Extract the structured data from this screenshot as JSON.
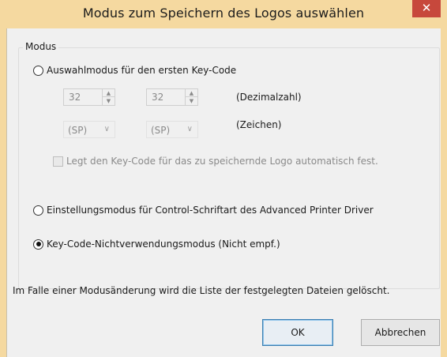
{
  "window": {
    "title": "Modus zum Speichern des Logos auswählen",
    "close_glyph": "✕"
  },
  "group": {
    "label": "Modus"
  },
  "options": [
    {
      "label": "Auswahlmodus für den ersten Key-Code",
      "checked": false
    },
    {
      "label": "Einstellungsmodus für Control-Schriftart des Advanced Printer Driver",
      "checked": false
    },
    {
      "label": "Key-Code-Nichtverwendungsmodus (Nicht empf.)",
      "checked": true
    }
  ],
  "keycode": {
    "spin1_value": "32",
    "spin2_value": "32",
    "decimal_label": "(Dezimalzahl)",
    "combo1_value": "(SP)",
    "combo2_value": "(SP)",
    "char_label": "(Zeichen)",
    "auto_checkbox_label": "Legt den Key-Code für das zu speichernde Logo automatisch fest.",
    "auto_checkbox_checked": false
  },
  "note": "Im Falle einer Modusänderung wird die Liste der festgelegten Dateien gelöscht.",
  "buttons": {
    "ok": "OK",
    "cancel": "Abbrechen"
  },
  "colors": {
    "titlebar": "#f5d9a0",
    "close": "#c7483c",
    "client": "#f0f0f0"
  },
  "icons": {
    "spin_up": "▲",
    "spin_down": "▼",
    "combo_arrow": "∨"
  }
}
